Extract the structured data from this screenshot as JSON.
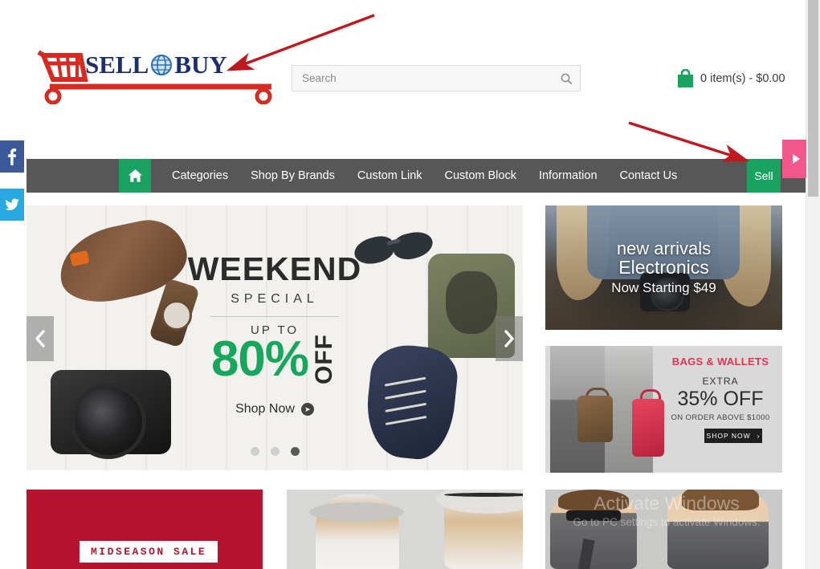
{
  "site": {
    "logo": {
      "text_left": "SELL",
      "text_right": "BUY",
      "icon": "shopping-cart-icon",
      "globe_icon": "globe-icon"
    }
  },
  "search": {
    "placeholder": "Search",
    "value": "",
    "button_icon": "search-icon"
  },
  "cart": {
    "icon": "shopping-bag-icon",
    "summary": "0 item(s) - $0.00"
  },
  "social": [
    {
      "name": "facebook",
      "glyph": "f",
      "color": "#3b5998"
    },
    {
      "name": "twitter",
      "glyph": "twitter-bird-icon",
      "color": "#29a9e1"
    }
  ],
  "side_tab": {
    "name": "slide-out-toggle",
    "icon": "play-triangle-icon",
    "color": "#f4578c"
  },
  "nav": {
    "home_icon": "home-icon",
    "items": [
      {
        "label": "Categories"
      },
      {
        "label": "Shop By Brands"
      },
      {
        "label": "Custom Link"
      },
      {
        "label": "Custom Block"
      },
      {
        "label": "Information"
      },
      {
        "label": "Contact Us"
      }
    ],
    "sell_label": "Sell",
    "bar_color": "#575757",
    "accent_color": "#1aa260"
  },
  "carousel": {
    "prev_icon": "chevron-left-icon",
    "next_icon": "chevron-right-icon",
    "dots": [
      {
        "active": false
      },
      {
        "active": false
      },
      {
        "active": true
      }
    ],
    "slide": {
      "title": "WEEKEND",
      "subtitle": "SPECIAL",
      "upto": "UP TO",
      "percent": "80%",
      "off": "OFF",
      "cta": "Shop Now",
      "cta_icon": "chevron-right-circle-icon",
      "accent_color": "#16a75c"
    }
  },
  "banners": {
    "electronics": {
      "line1": "new arrivals",
      "line2": "Electronics",
      "line3": "Now Starting $49"
    },
    "bags": {
      "title": "BAGS & WALLETS",
      "extra": "EXTRA",
      "percent": "35% OFF",
      "condition": "ON ORDER ABOVE $1000",
      "cta": "SHOP NOW",
      "cta_icon": "chevron-right-icon",
      "title_color": "#e03552"
    }
  },
  "tiles": [
    {
      "name": "midseason-sale",
      "label": "MIDSEASON SALE"
    },
    {
      "name": "womens-fashion",
      "label": ""
    },
    {
      "name": "mens-fashion",
      "label": ""
    }
  ],
  "watermark": {
    "line1": "Activate Windows",
    "line2": "Go to PC settings to activate Windows."
  },
  "annotations": [
    {
      "name": "arrow-to-logo",
      "color": "#c0181f"
    },
    {
      "name": "arrow-to-sell-button",
      "color": "#c0181f"
    }
  ]
}
